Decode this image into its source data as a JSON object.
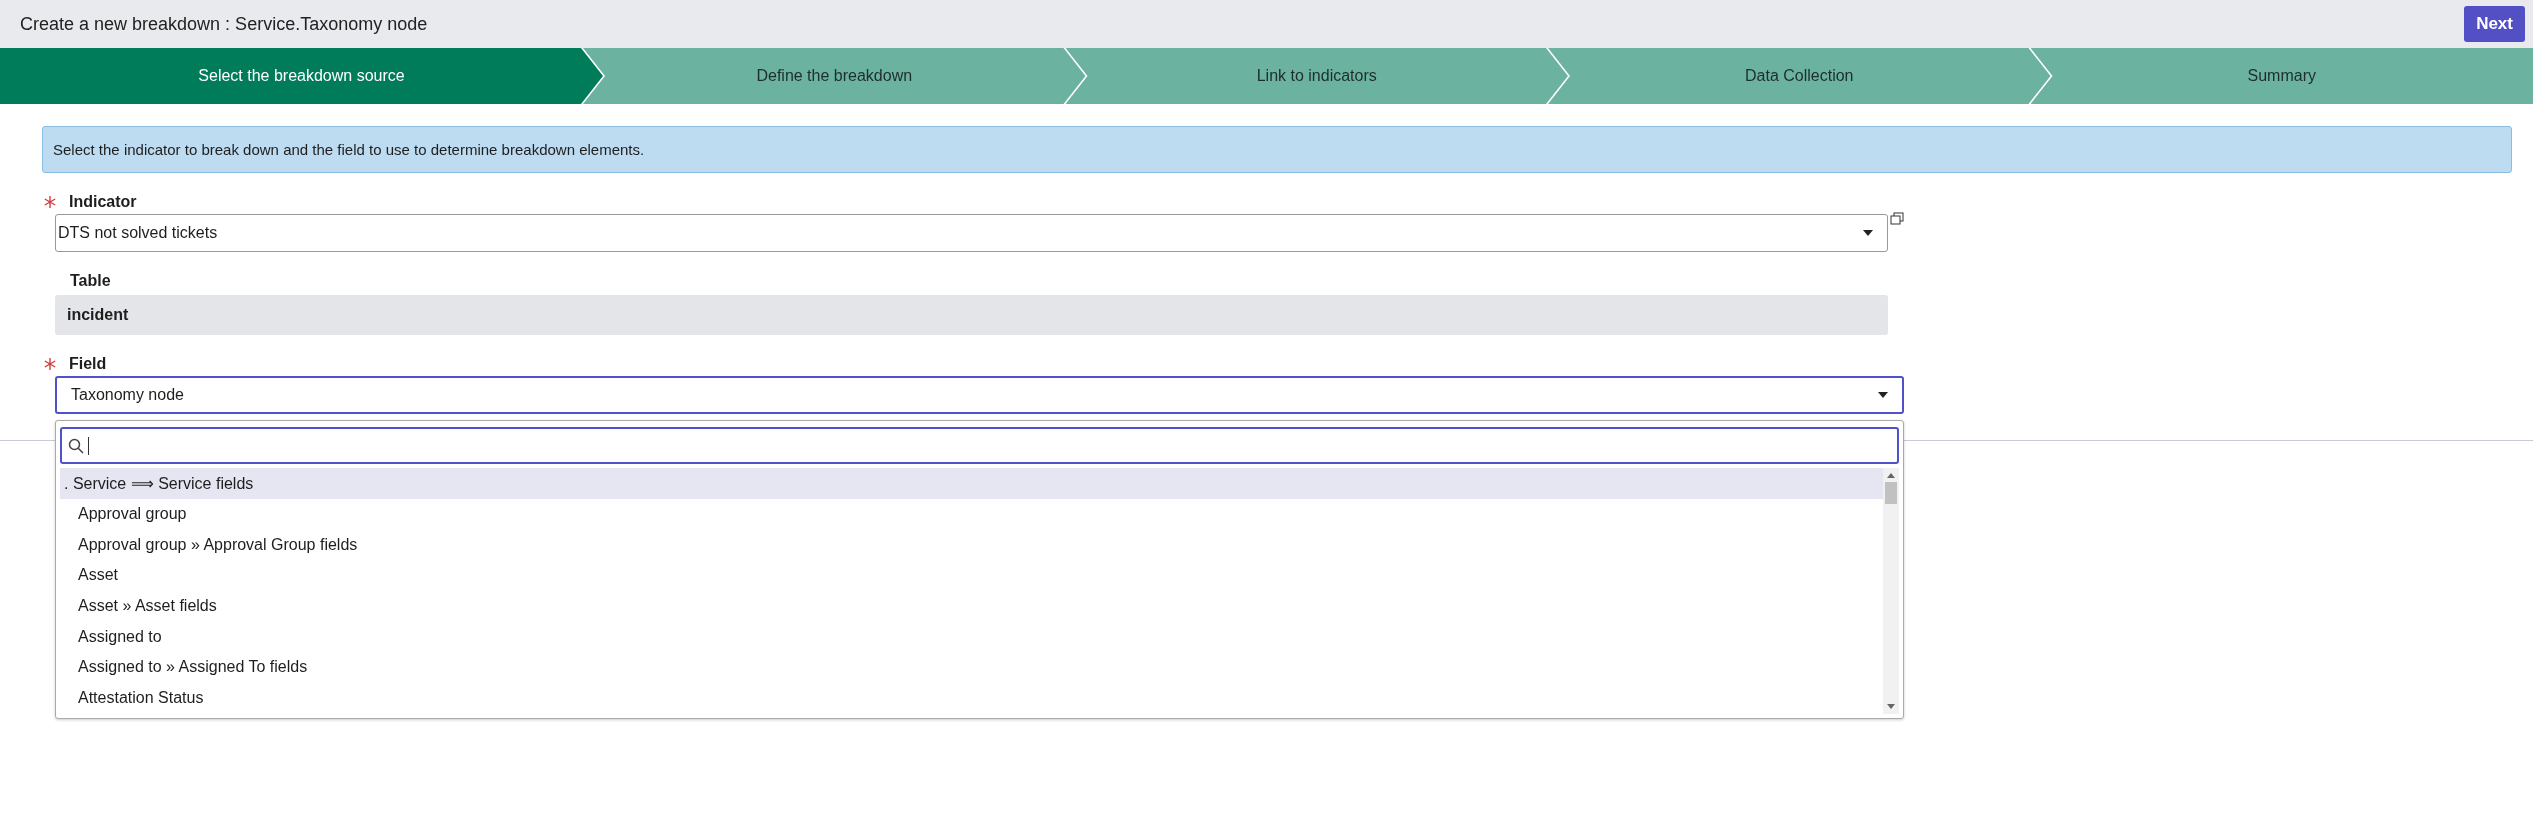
{
  "header": {
    "title": "Create a new breakdown : Service.Taxonomy node",
    "next_button": "Next"
  },
  "steps": [
    {
      "label": "Select the breakdown source",
      "selected": true
    },
    {
      "label": "Define the breakdown",
      "selected": false
    },
    {
      "label": "Link to indicators",
      "selected": false
    },
    {
      "label": "Data Collection",
      "selected": false
    },
    {
      "label": "Summary",
      "selected": false
    }
  ],
  "info": "Select the indicator to break down and the field to use to determine breakdown elements.",
  "form": [
    {
      "kind": "select",
      "label": "Indicator",
      "required": true,
      "value": "DTS not solved tickets"
    },
    {
      "kind": "readonly",
      "label": "Table",
      "required": false,
      "value": "incident"
    },
    {
      "kind": "select",
      "label": "Field",
      "required": true,
      "value": "Taxonomy node"
    }
  ],
  "dropdown": {
    "items": [
      {
        "label": ". Service ⟹ Service fields",
        "selected": true
      },
      {
        "label": "Approval group",
        "selected": false
      },
      {
        "label": "Approval group » Approval Group fields",
        "selected": false
      },
      {
        "label": "Asset",
        "selected": false
      },
      {
        "label": "Asset » Asset fields",
        "selected": false
      },
      {
        "label": "Assigned to",
        "selected": false
      },
      {
        "label": "Assigned to » Assigned To fields",
        "selected": false
      },
      {
        "label": "Attestation Status",
        "selected": false
      }
    ]
  }
}
